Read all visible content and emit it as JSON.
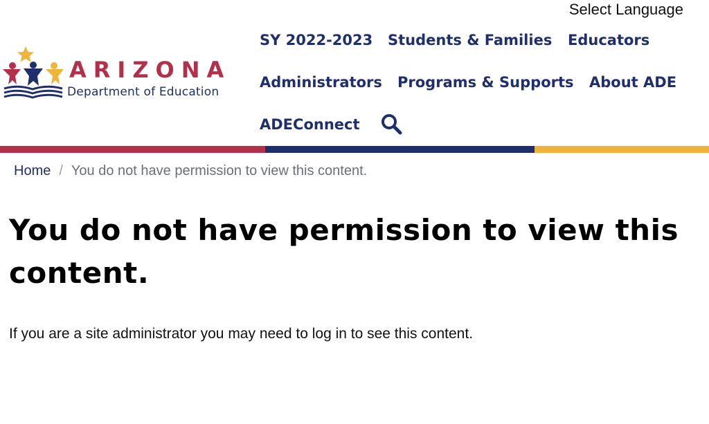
{
  "header": {
    "language_label": "Select Language",
    "logo": {
      "title": "ARIZONA",
      "subtitle": "Department of Education",
      "colors": {
        "red": "#b3304a",
        "navy": "#1f2f6d",
        "gold": "#f0b43c"
      }
    },
    "nav": {
      "items": [
        {
          "label": "SY 2022-2023"
        },
        {
          "label": "Students & Families"
        },
        {
          "label": "Educators"
        },
        {
          "label": "Administrators"
        },
        {
          "label": "Programs & Supports"
        },
        {
          "label": "About ADE"
        },
        {
          "label": "ADEConnect"
        }
      ],
      "search_icon": "search-icon"
    },
    "divider_colors": [
      "#b3304a",
      "#1f2f6d",
      "#f0b43c"
    ]
  },
  "breadcrumb": {
    "home": "Home",
    "separator": "/",
    "current": "You do not have permission to view this content."
  },
  "main": {
    "title": "You do not have permission to view this content.",
    "message": "If you are a site administrator you may need to log in to see this content."
  }
}
